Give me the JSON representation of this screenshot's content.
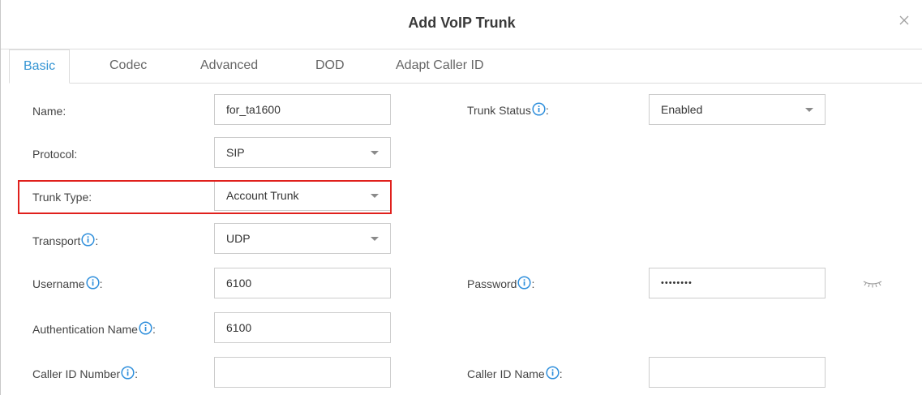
{
  "dialog": {
    "title": "Add VoIP Trunk",
    "close_icon": "close-icon"
  },
  "tabs": [
    {
      "label": "Basic",
      "active": true
    },
    {
      "label": "Codec",
      "active": false
    },
    {
      "label": "Advanced",
      "active": false
    },
    {
      "label": "DOD",
      "active": false
    },
    {
      "label": "Adapt Caller ID",
      "active": false
    }
  ],
  "form": {
    "name": {
      "label": "Name:",
      "value": "for_ta1600"
    },
    "protocol": {
      "label": "Protocol:",
      "value": "SIP"
    },
    "trunk_type": {
      "label": "Trunk Type:",
      "value": "Account Trunk"
    },
    "transport": {
      "label": "Transport",
      "suffix": ":",
      "value": "UDP"
    },
    "username": {
      "label": "Username",
      "suffix": ":",
      "value": "6100"
    },
    "auth_name": {
      "label": "Authentication Name",
      "suffix": ":",
      "value": "6100"
    },
    "caller_id_number": {
      "label": "Caller ID Number",
      "suffix": ":",
      "value": ""
    },
    "trunk_status": {
      "label": "Trunk Status",
      "suffix": ":",
      "value": "Enabled"
    },
    "password": {
      "label": "Password",
      "suffix": ":",
      "value": "••••••••"
    },
    "caller_id_name": {
      "label": "Caller ID Name",
      "suffix": ":",
      "value": ""
    }
  },
  "colors": {
    "accent": "#3394d3",
    "highlight": "#e0201c",
    "info_icon": "#2f8fdc"
  },
  "icons": {
    "info": "info-icon",
    "dropdown": "chevron-down-icon",
    "password_toggle": "eye-closed-icon"
  }
}
